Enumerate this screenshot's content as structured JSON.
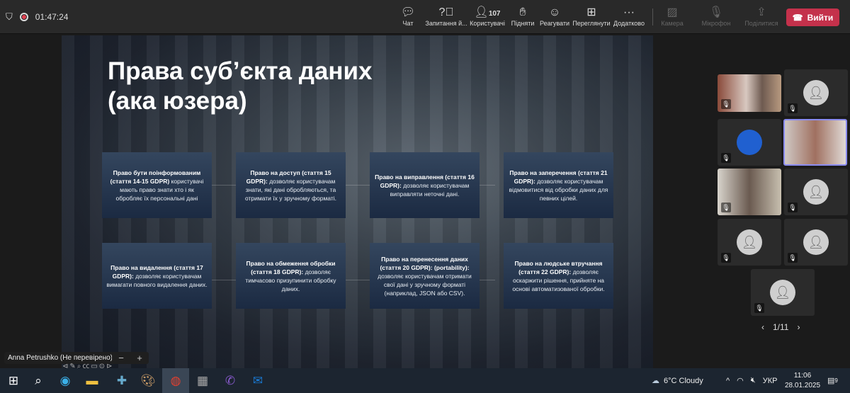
{
  "topbar": {
    "timer": "01:47:24",
    "participants_count": "107",
    "buttons": [
      {
        "icon": "chat-icon",
        "label": "Чат"
      },
      {
        "icon": "question-icon",
        "label": "Запитання й..."
      },
      {
        "icon": "people-icon",
        "label": "Користувачі"
      },
      {
        "icon": "hand-icon",
        "label": "Підняти"
      },
      {
        "icon": "smile-icon",
        "label": "Реагувати"
      },
      {
        "icon": "grid-icon",
        "label": "Переглянути"
      },
      {
        "icon": "more-icon",
        "label": "Додатково"
      }
    ],
    "disabled": [
      {
        "icon": "camera-off-icon",
        "label": "Камера"
      },
      {
        "icon": "mic-off-icon",
        "label": "Мікрофон"
      },
      {
        "icon": "share-icon",
        "label": "Поділитися"
      }
    ],
    "leave_label": "Вийти",
    "leave_color": "#c4314b"
  },
  "slide": {
    "title_line1": "Права суб’єкта даних",
    "title_line2": "(ака юзера)",
    "cards": [
      {
        "bold": "Право бути поінформованим (стаття 14-15 GDPR)",
        "text": " користувачі мають право знати хто і як обробляє їх персональні дані"
      },
      {
        "bold": "Право на доступ (стаття 15 GDPR):",
        "text": " дозволяє користувачам знати, які дані обробляються, та отримати їх у зручному форматі."
      },
      {
        "bold": "Право на виправлення (стаття 16 GDPR):",
        "text": " дозволяє користувачам виправляти неточні дані."
      },
      {
        "bold": "Право на заперечення (стаття 21 GDPR):",
        "text": " дозволяє користувачам відмовитися від обробки даних для певних цілей."
      },
      {
        "bold": "Право на видалення (стаття 17 GDPR):",
        "text": " дозволяє користувачам вимагати повного видалення даних."
      },
      {
        "bold": "Право на обмеження обробки (стаття 18 GDPR):",
        "text": " дозволяє тимчасово призупинити обробку даних."
      },
      {
        "bold": "Право на перенесення даних (стаття 20 GDPR): (portability):",
        "text": " дозволяє користувачам отримати свої дані у зручному форматі (наприклад, JSON або CSV)."
      },
      {
        "bold": "Право на людське втручання (стаття 22 GDPR):",
        "text": " дозволяє оскаржити рішення, прийняте на основі автоматизованої обробки."
      }
    ]
  },
  "presenter": {
    "name": "Anna Petrushko (Не перевірено)",
    "zoom_out": "−",
    "zoom_in": "+"
  },
  "pager": {
    "label": "1/11"
  },
  "taskbar": {
    "weather": "6°C  Cloudy",
    "lang": "УКР",
    "time": "11:06",
    "date": "28.01.2025",
    "notifications": "9"
  }
}
